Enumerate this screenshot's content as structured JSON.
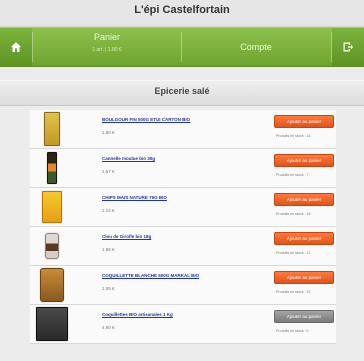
{
  "header": {
    "shop_title": "L'épi Castelfortain"
  },
  "nav": {
    "cart_label": "Panier",
    "cart_sub": "1 art. | 1.80 €",
    "account_label": "Compte"
  },
  "category": {
    "title": "Epicerie salé"
  },
  "products": [
    {
      "name": "BOULGOUR FIN 500G ETUI CARTON BIO",
      "price": "1.80 €",
      "button": "Ajouter au panier",
      "stock": "Produits en stock : 14",
      "pkg_color": "#d8b33a",
      "disabled": false
    },
    {
      "name": "Cannelle moulue bio 30g",
      "price": "1.67 €",
      "button": "Ajouter au panier",
      "stock": "Produits en stock : 7",
      "pkg_color": "#4a3a24",
      "disabled": false
    },
    {
      "name": "CHIPS MAIS NATURE 75G BIO",
      "price": "1.14 €",
      "button": "Ajouter au panier",
      "stock": "Produits en stock : 18",
      "pkg_color": "#f0b71e",
      "disabled": false
    },
    {
      "name": "Clou de Girofle bio 18g",
      "price": "1.56 €",
      "button": "Ajouter au panier",
      "stock": "Produits en stock : 12",
      "pkg_color": "#c9c2b8",
      "disabled": false
    },
    {
      "name": "COQUILLETTE BLANCHE 500G MARKAL BIO",
      "price": "1.55 €",
      "button": "Ajouter au panier",
      "stock": "Produits en stock : 15",
      "pkg_color": "#b97a2e",
      "disabled": false
    },
    {
      "name": "Coquillettes BIO artisanales 1 Kg",
      "price": "4.90 €",
      "button": "Ajouter au panier",
      "stock": "Produits en stock : 0",
      "pkg_color": "#3b3b3b",
      "disabled": true
    }
  ],
  "colors": {
    "accent_green": "#7cb43b",
    "button_orange": "#f0632a",
    "link_blue": "#2233a8"
  }
}
